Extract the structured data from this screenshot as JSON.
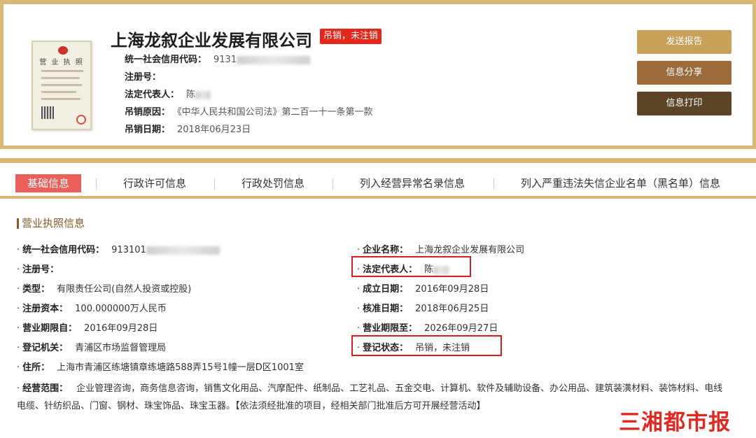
{
  "company": {
    "name": "上海龙叙企业发展有限公司",
    "status_badge": "吊销，未注销",
    "cert_title": "营 业 执 照",
    "info": [
      {
        "label": "统一社会信用代码：",
        "value": "9131"
      },
      {
        "label": "注册号：",
        "value": ""
      },
      {
        "label": "法定代表人：",
        "value": "陈"
      },
      {
        "label": "吊销原因：",
        "value": "《中华人民共和国公司法》第二百一十一条第一款"
      },
      {
        "label": "吊销日期：",
        "value": "2018年06月23日"
      }
    ]
  },
  "actions": {
    "send_report": "发送报告",
    "share": "信息分享",
    "print": "信息打印"
  },
  "colors": {
    "accent": "#d9b878",
    "badge": "#e3271b",
    "tab_active": "#e9605b",
    "btn1": "#c8a05a",
    "btn2": "#9b6b3b",
    "btn3": "#5e4426",
    "highlight": "#d61e1e",
    "section": "#8a5a2c"
  },
  "tabs": [
    "基础信息",
    "行政许可信息",
    "行政处罚信息",
    "列入经营异常名录信息",
    "列入严重违法失信企业名单（黑名单）信息"
  ],
  "section_title": "营业执照信息",
  "fields_left": [
    {
      "label": "统一社会信用代码：",
      "value": "913101"
    },
    {
      "label": "注册号：",
      "value": ""
    },
    {
      "label": "类型：",
      "value": "有限责任公司(自然人投资或控股)"
    },
    {
      "label": "注册资本：",
      "value": "100.000000万人民币"
    },
    {
      "label": "营业期限自：",
      "value": "2016年09月28日"
    },
    {
      "label": "登记机关：",
      "value": "青浦区市场监督管理局"
    },
    {
      "label": "住所：",
      "value": "上海市青浦区练塘镇章练塘路588弄15号1幢一层D区1001室"
    }
  ],
  "fields_right": [
    {
      "label": "企业名称：",
      "value": "上海龙叙企业发展有限公司"
    },
    {
      "label": "法定代表人：",
      "value": "陈"
    },
    {
      "label": "成立日期：",
      "value": "2016年09月28日"
    },
    {
      "label": "核准日期：",
      "value": "2018年06月25日"
    },
    {
      "label": "营业期限至：",
      "value": "2026年09月27日"
    },
    {
      "label": "登记状态：",
      "value": "吊销，未注销"
    }
  ],
  "scope": {
    "label": "经营范围：",
    "value": "企业管理咨询，商务信息咨询，销售文化用品、汽摩配件、纸制品、工艺礼品、五金交电、计算机、软件及辅助设备、办公用品、建筑装潢材料、装饰材料、电线电缆、针纺织品、门窗、钢材、珠宝饰品、珠宝玉器。【依法须经批准的项目，经相关部门批准后方可开展经营活动】"
  },
  "watermark": "三湘都市报"
}
